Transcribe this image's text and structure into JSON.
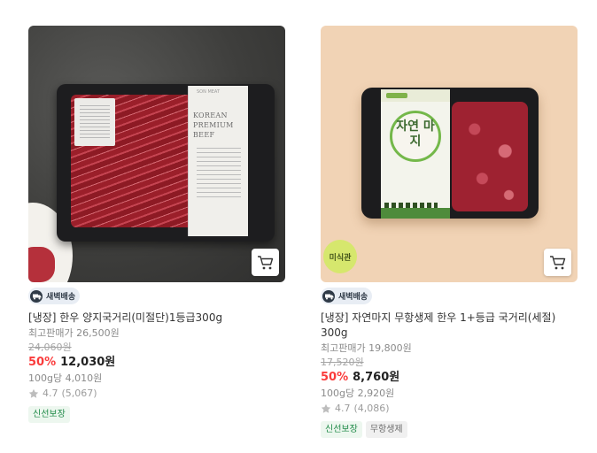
{
  "products": [
    {
      "delivery_badge": "새벽배송",
      "name": "[냉장] 한우 양지국거리(미절단)1등급300g",
      "max_price": "최고판매가 26,500원",
      "original_price": "24,060원",
      "discount_rate": "50%",
      "price": "12,030원",
      "unit_price": "100g당 4,010원",
      "rating": "4.7",
      "review_count": "(5,067)",
      "tags": [
        "신선보장"
      ],
      "package_label": "KOREAN PREMIUM BEEF",
      "package_sub": "SON MEAT"
    },
    {
      "delivery_badge": "새벽배송",
      "name": "[냉장] 자연마지 무항생제 한우 1+등급 국거리(세절) 300g",
      "max_price": "최고판매가 19,800원",
      "original_price": "17,520원",
      "discount_rate": "50%",
      "price": "8,760원",
      "unit_price": "100g당 2,920원",
      "rating": "4.7",
      "review_count": "(4,086)",
      "tags": [
        "신선보장",
        "무항생제"
      ],
      "image_flag": "미식관",
      "package_label": "자연 마지"
    }
  ],
  "colors": {
    "discount": "#fa3b3b",
    "tag_green_text": "#1f8a47",
    "tag_green_bg": "#edf7ef",
    "delivery_bg": "#e8edf4"
  },
  "icons": {
    "cart": "cart-icon",
    "truck": "truck-icon",
    "star": "star-icon"
  }
}
